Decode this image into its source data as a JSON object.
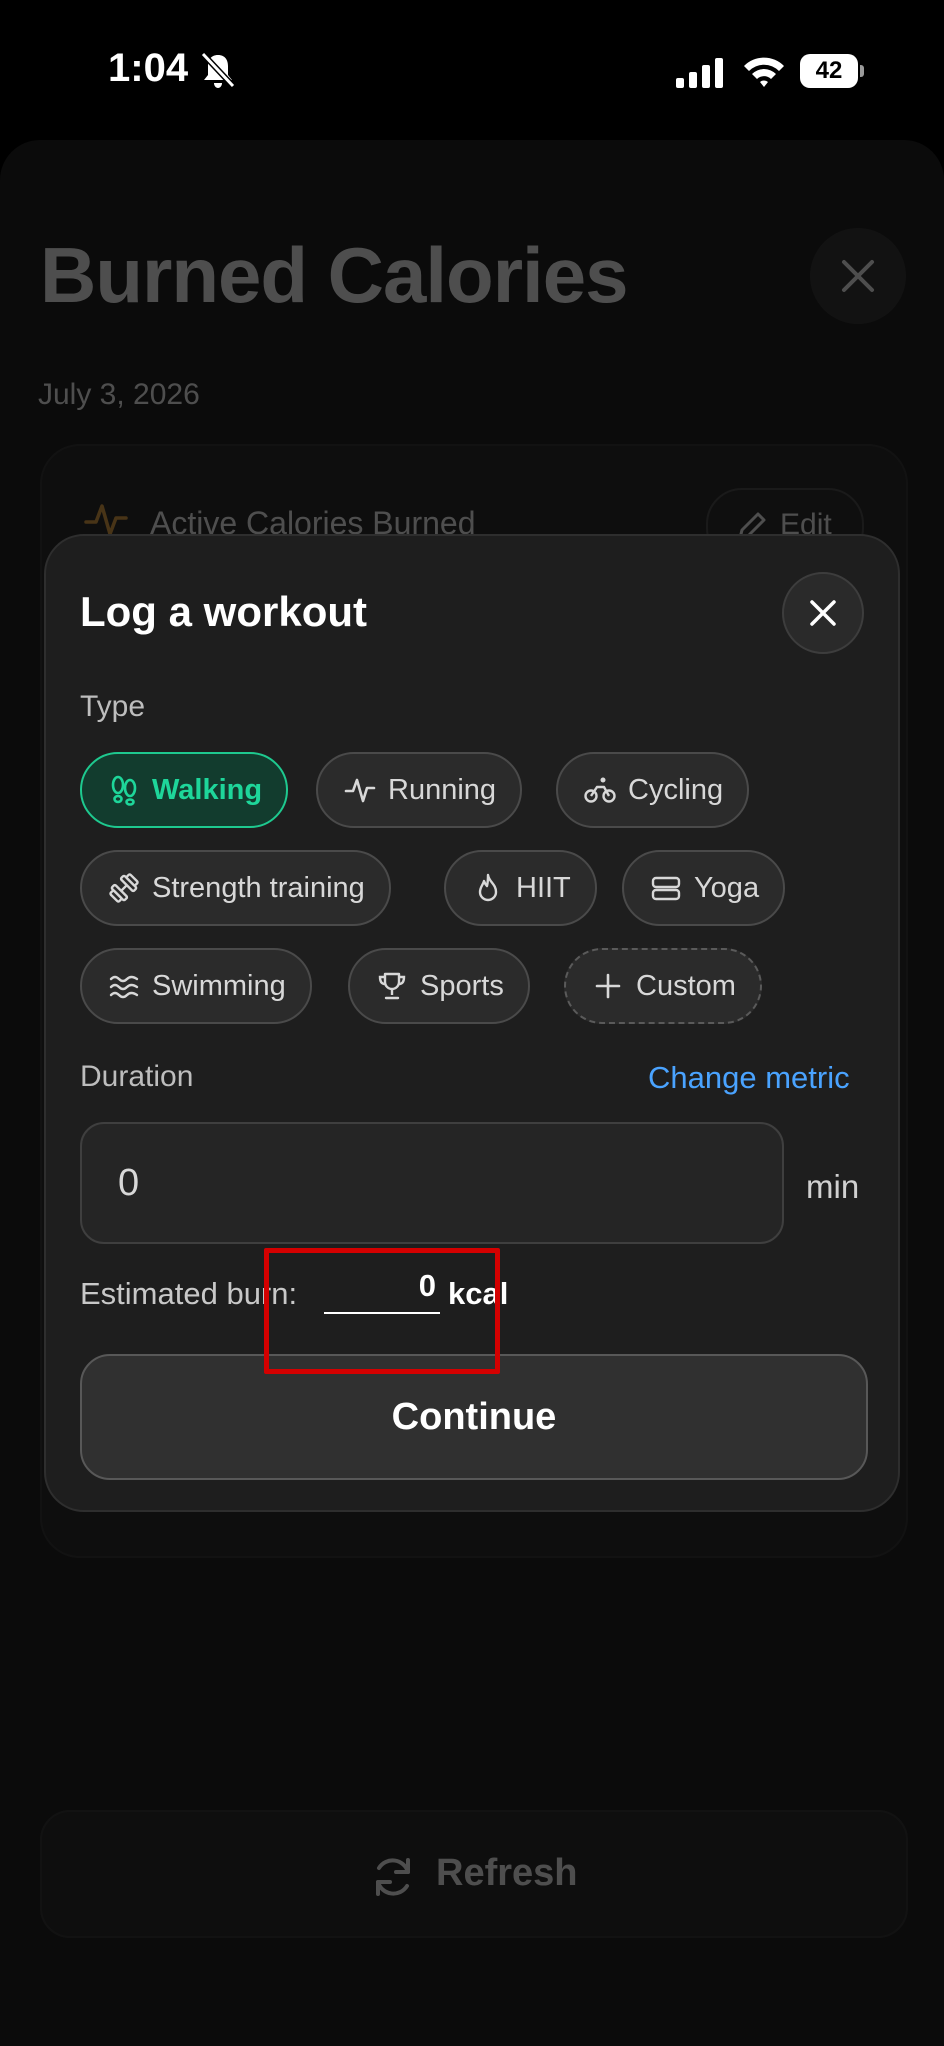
{
  "status_bar": {
    "time": "1:04",
    "battery": "42"
  },
  "background": {
    "title": "Burned Calories",
    "date": "July 3, 2026",
    "card_heading": "Active Calories Burned",
    "edit_label": "Edit",
    "refresh_label": "Refresh"
  },
  "modal": {
    "title": "Log a workout",
    "type_label": "Type",
    "types": [
      {
        "label": "Walking",
        "icon": "footprints-icon",
        "selected": true
      },
      {
        "label": "Running",
        "icon": "activity-icon"
      },
      {
        "label": "Cycling",
        "icon": "bicycle-icon"
      },
      {
        "label": "Strength training",
        "icon": "dumbbell-icon"
      },
      {
        "label": "HIIT",
        "icon": "flame-icon"
      },
      {
        "label": "Yoga",
        "icon": "yoga-icon"
      },
      {
        "label": "Swimming",
        "icon": "waves-icon"
      },
      {
        "label": "Sports",
        "icon": "trophy-icon"
      },
      {
        "label": "Custom",
        "icon": "plus-icon"
      }
    ],
    "duration_label": "Duration",
    "change_metric": "Change metric",
    "duration_value": "0",
    "duration_unit": "min",
    "estimated_label": "Estimated burn:",
    "estimated_value": "0",
    "estimated_unit": "kcal",
    "continue_label": "Continue"
  },
  "colors": {
    "accent_green": "#1ED69A",
    "link_blue": "#4AA3FF",
    "highlight_red": "#D40000"
  }
}
